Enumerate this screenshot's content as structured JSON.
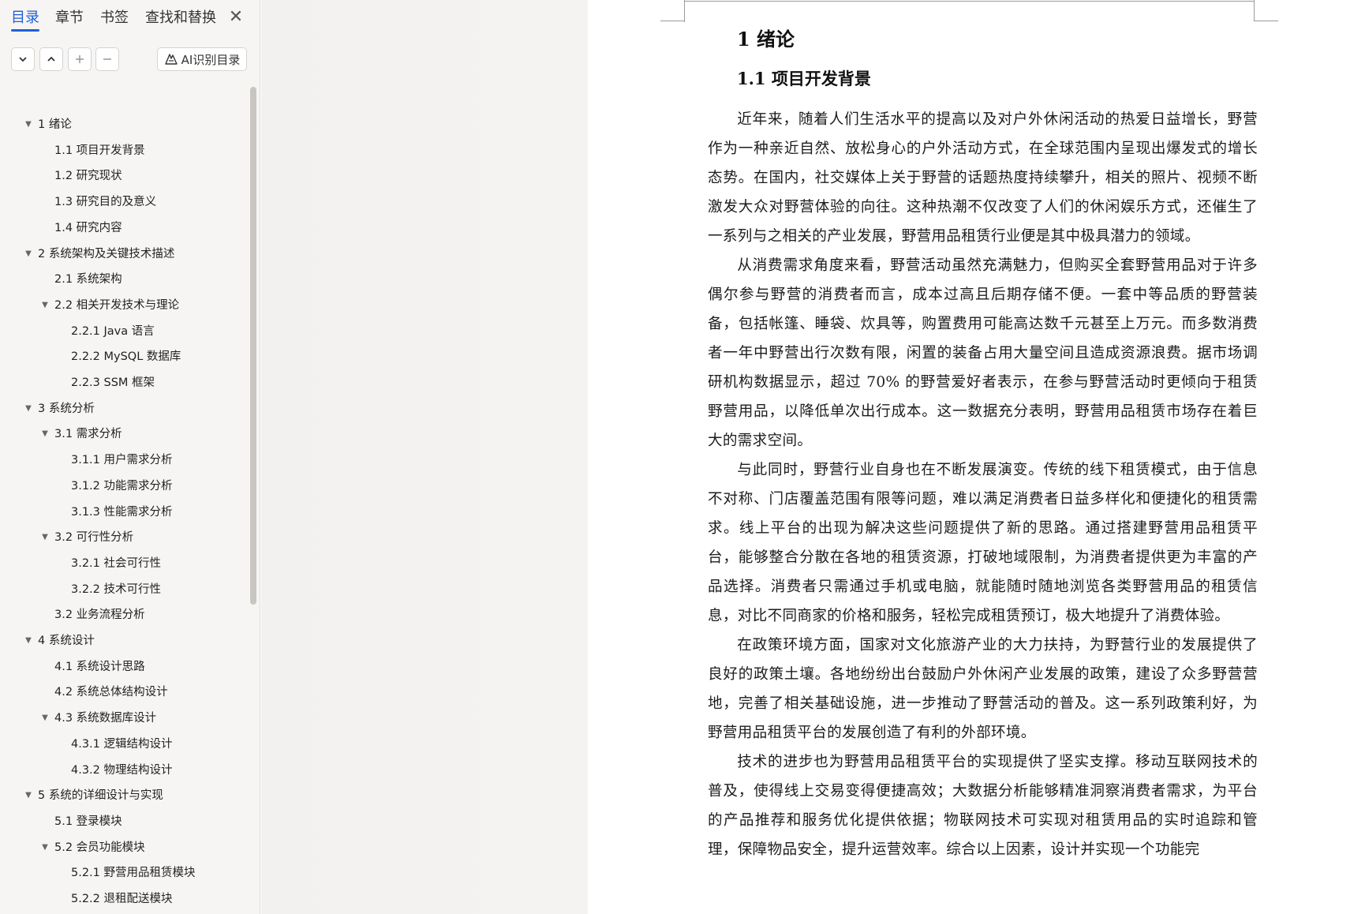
{
  "nav": {
    "tabs": [
      "目录",
      "章节",
      "书签",
      "查找和替换"
    ],
    "active_tab": 0,
    "close_glyph": "✕",
    "toolbar": {
      "expand_icon": "chevron-down-icon",
      "collapse_icon": "chevron-up-icon",
      "add_icon": "plus-icon",
      "remove_icon": "minus-icon",
      "ai_label": "AI识别目录"
    },
    "toc": [
      {
        "label": "1  绪论",
        "level": 0,
        "expanded": true
      },
      {
        "label": "1.1  项目开发背景",
        "level": 1
      },
      {
        "label": "1.2  研究现状",
        "level": 1
      },
      {
        "label": "1.3  研究目的及意义",
        "level": 1
      },
      {
        "label": "1.4  研究内容",
        "level": 1
      },
      {
        "label": "2  系统架构及关键技术描述",
        "level": 0,
        "expanded": true
      },
      {
        "label": "2.1  系统架构",
        "level": 1
      },
      {
        "label": "2.2  相关开发技术与理论",
        "level": 1,
        "expanded": true
      },
      {
        "label": "2.2.1 Java 语言",
        "level": 2
      },
      {
        "label": "2.2.2 MySQL 数据库",
        "level": 2
      },
      {
        "label": "2.2.3 SSM 框架",
        "level": 2
      },
      {
        "label": "3  系统分析",
        "level": 0,
        "expanded": true
      },
      {
        "label": "3.1  需求分析",
        "level": 1,
        "expanded": true
      },
      {
        "label": "3.1.1  用户需求分析",
        "level": 2
      },
      {
        "label": "3.1.2  功能需求分析",
        "level": 2
      },
      {
        "label": "3.1.3  性能需求分析",
        "level": 2
      },
      {
        "label": "3.2  可行性分析",
        "level": 1,
        "expanded": true
      },
      {
        "label": "3.2.1  社会可行性",
        "level": 2
      },
      {
        "label": "3.2.2  技术可行性",
        "level": 2
      },
      {
        "label": "3.2  业务流程分析",
        "level": 1
      },
      {
        "label": "4  系统设计",
        "level": 0,
        "expanded": true
      },
      {
        "label": "4.1  系统设计思路",
        "level": 1
      },
      {
        "label": "4.2  系统总体结构设计",
        "level": 1
      },
      {
        "label": "4.3  系统数据库设计",
        "level": 1,
        "expanded": true
      },
      {
        "label": "4.3.1  逻辑结构设计",
        "level": 2
      },
      {
        "label": "4.3.2  物理结构设计",
        "level": 2
      },
      {
        "label": "5  系统的详细设计与实现",
        "level": 0,
        "expanded": true
      },
      {
        "label": "5.1  登录模块",
        "level": 1
      },
      {
        "label": "5.2  会员功能模块",
        "level": 1,
        "expanded": true
      },
      {
        "label": "5.2.1  野营用品租赁模块",
        "level": 2
      },
      {
        "label": "5.2.2  退租配送模块",
        "level": 2
      }
    ]
  },
  "document": {
    "heading1": "1  绪论",
    "heading2": "1.1 项目开发背景",
    "paragraphs": [
      "近年来，随着人们生活水平的提高以及对户外休闲活动的热爱日益增长，野营作为一种亲近自然、放松身心的户外活动方式，在全球范围内呈现出爆发式的增长态势。在国内，社交媒体上关于野营的话题热度持续攀升，相关的照片、视频不断激发大众对野营体验的向往。这种热潮不仅改变了人们的休闲娱乐方式，还催生了一系列与之相关的产业发展，野营用品租赁行业便是其中极具潜力的领域。",
      "从消费需求角度来看，野营活动虽然充满魅力，但购买全套野营用品对于许多偶尔参与野营的消费者而言，成本过高且后期存储不便。一套中等品质的野营装备，包括帐篷、睡袋、炊具等，购置费用可能高达数千元甚至上万元。而多数消费者一年中野营出行次数有限，闲置的装备占用大量空间且造成资源浪费。据市场调研机构数据显示，超过 70% 的野营爱好者表示，在参与野营活动时更倾向于租赁野营用品，以降低单次出行成本。这一数据充分表明，野营用品租赁市场存在着巨大的需求空间。",
      "与此同时，野营行业自身也在不断发展演变。传统的线下租赁模式，由于信息不对称、门店覆盖范围有限等问题，难以满足消费者日益多样化和便捷化的租赁需求。线上平台的出现为解决这些问题提供了新的思路。通过搭建野营用品租赁平台，能够整合分散在各地的租赁资源，打破地域限制，为消费者提供更为丰富的产品选择。消费者只需通过手机或电脑，就能随时随地浏览各类野营用品的租赁信息，对比不同商家的价格和服务，轻松完成租赁预订，极大地提升了消费体验。",
      "在政策环境方面，国家对文化旅游产业的大力扶持，为野营行业的发展提供了良好的政策土壤。各地纷纷出台鼓励户外休闲产业发展的政策，建设了众多野营营地，完善了相关基础设施，进一步推动了野营活动的普及。这一系列政策利好，为野营用品租赁平台的发展创造了有利的外部环境。",
      "技术的进步也为野营用品租赁平台的实现提供了坚实支撑。移动互联网技术的普及，使得线上交易变得便捷高效；大数据分析能够精准洞察消费者需求，为平台的产品推荐和服务优化提供依据；物联网技术可实现对租赁用品的实时追踪和管理，保障物品安全，提升运营效率。综合以上因素，设计并实现一个功能完"
    ]
  }
}
